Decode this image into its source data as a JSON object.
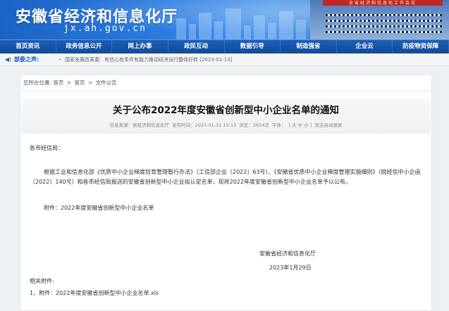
{
  "header": {
    "site_title": "安徽省经济和信息化厅",
    "site_domain": "jx.ah.gov.cn"
  },
  "nav": {
    "items": [
      "首页资讯",
      "政务信息公开",
      "网上办事",
      "政民互动",
      "数据引导",
      "制造强省",
      "企业云",
      "防疫物资保障"
    ]
  },
  "ticker": {
    "label": "部委之声:",
    "text": "国家发展改革委：有信心有条件有能力推动经济运行整体好转 [2023-01-13]"
  },
  "breadcrumb": {
    "prefix": "您所在位置:",
    "items": [
      "首页",
      "首页",
      "文件公告"
    ],
    "separator": ">"
  },
  "article": {
    "title": "关于公布2022年度安徽省创新型中小企业名单的通知",
    "meta": {
      "source": "信息来源：省经济和信息化厅",
      "time": "发布时间：2023-01-31 10:13",
      "views": "浏览：2654次",
      "font_label": "字体：",
      "font_sizes": "[ 大 中 小 ]",
      "autoscroll": "双击自动滚屏"
    },
    "greeting": "各市经信局：",
    "paragraph": "根据工业和信息化部《优质中小企业梯度培育管理暂行办法》（工信部企业〔2022〕63号）、《安徽省优质中小企业梯度管理实施细则》（皖经信中小企函〔2022〕140号）和各市经信局报送的安徽省创新型中小企业拟认定名单，现将2022年度安徽省创新型中小企业名单予以公布。",
    "attachment_line": "附件：2022年度安徽省创新型中小企业名单",
    "sign_org": "安徽省经济和信息化厅",
    "sign_date": "2023年1月29日",
    "related_label": "相关附件:",
    "related_item": "1、附件：2022年度安徽省创新型中小企业名单.xls"
  },
  "hall": {
    "banner_text": "全省经济和信息化工作会议"
  },
  "colors": {
    "nav_bg": "#124a96",
    "banner_blue": "#2b7be0",
    "accent_red": "#c0282a"
  }
}
